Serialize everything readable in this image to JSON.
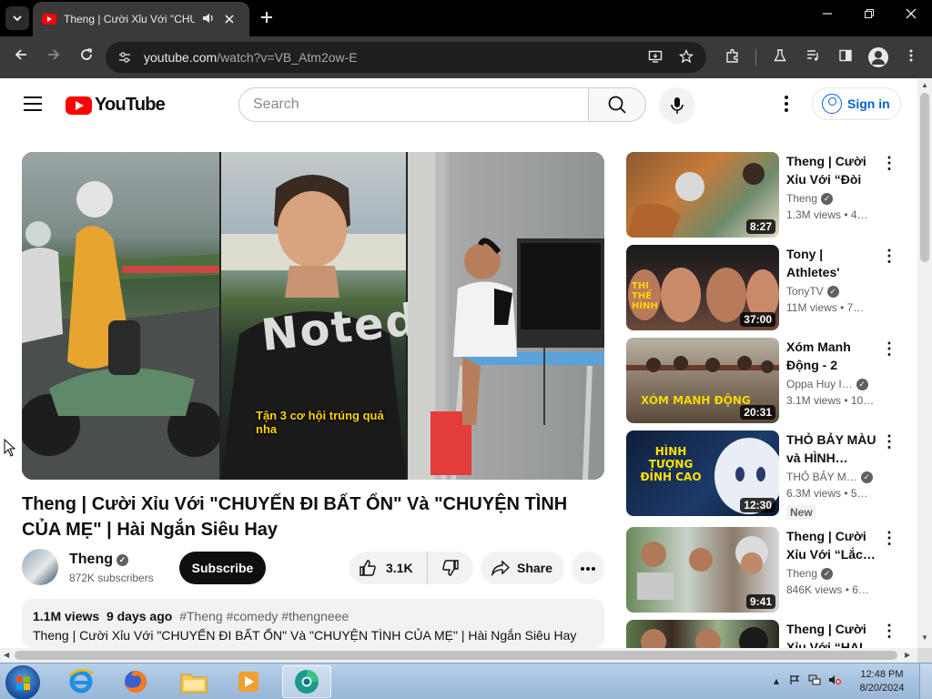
{
  "browser": {
    "tab_title": "Theng | Cười Xỉu Với \"CHU",
    "url_host": "youtube.com",
    "url_path": "/watch?v=VB_Atm2ow-E"
  },
  "header": {
    "logo_text": "YouTube",
    "search_placeholder": "Search",
    "signin_label": "Sign in"
  },
  "video": {
    "caption": "Tận 3 cơ hội trúng quả nha",
    "shirt_print": "Noted",
    "title": "Theng | Cười Xỉu Với \"CHUYẾN ĐI BẤT ỔN\" Và \"CHUYỆN TÌNH CỦA MẸ\" | Hài Ngắn Siêu Hay",
    "channel": "Theng",
    "subscribers": "872K subscribers",
    "subscribe_label": "Subscribe",
    "likes": "3.1K",
    "share_label": "Share",
    "views": "1.1M views",
    "age": "9 days ago",
    "tags": [
      "#Theng",
      "#comedy",
      "#thengneee"
    ],
    "desc_text": "Theng | Cười Xỉu Với \"CHUYẾN ĐI BẤT ỔN\" Và \"CHUYỆN TÌNH CỦA MẸ\" | Hài Ngắn Siêu Hay"
  },
  "recommendations": [
    {
      "title": "Theng | Cười Xỉu Với “Đòi Đ…",
      "channel": "Theng",
      "verified": true,
      "stats": "1.3M views  • 4…",
      "duration": "8:27",
      "badge": ""
    },
    {
      "title": "Tony | Athletes' Muscle…",
      "channel": "TonyTV",
      "verified": true,
      "stats": "11M views  • 7…",
      "duration": "37:00",
      "badge": "",
      "overlay": "THI THỂ HÌNH"
    },
    {
      "title": "Xóm Manh Động - 2",
      "channel": "Oppa Huy I…",
      "verified": true,
      "stats": "3.1M views  • 10…",
      "duration": "20:31",
      "badge": "",
      "overlay": "XÓM MANH ĐỘNG"
    },
    {
      "title": "THỎ BẢY MÀU và HÌNH…",
      "channel": "THỎ BẢY M…",
      "verified": true,
      "stats": "6.3M views  • 5…",
      "duration": "12:30",
      "badge": "New",
      "overlay": "HÌNH TƯỢNG ĐỈNH CAO"
    },
    {
      "title": "Theng | Cười Xỉu Với “Lắc…",
      "channel": "Theng",
      "verified": true,
      "stats": "846K views  • 6…",
      "duration": "9:41",
      "badge": ""
    },
    {
      "title": "Theng | Cười Xỉu Với “HAI…",
      "channel": "",
      "verified": false,
      "stats": "",
      "duration": "",
      "badge": ""
    }
  ],
  "taskbar": {
    "time": "12:48 PM",
    "date": "8/20/2024"
  }
}
